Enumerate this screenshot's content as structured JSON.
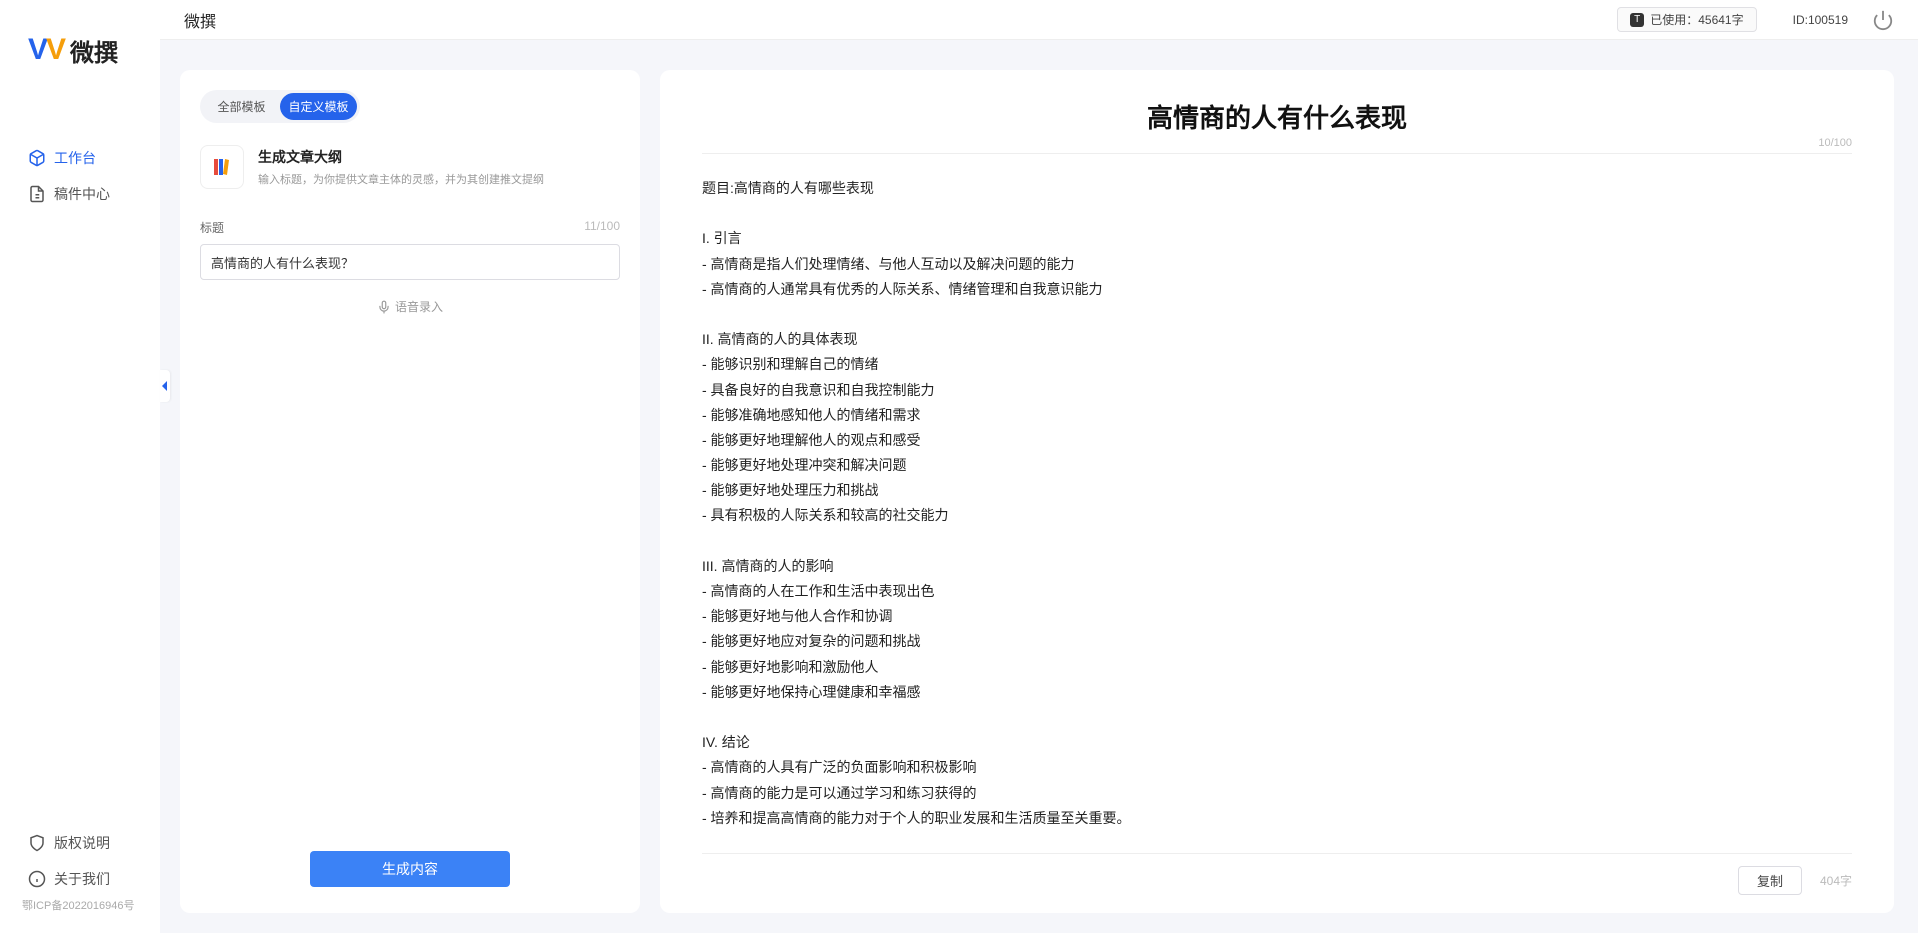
{
  "app": {
    "name": "微撰"
  },
  "logo": {
    "text": "微撰"
  },
  "sidebar": {
    "items": [
      {
        "label": "工作台"
      },
      {
        "label": "稿件中心"
      }
    ],
    "footer": [
      {
        "label": "版权说明"
      },
      {
        "label": "关于我们"
      }
    ],
    "icp": "鄂ICP备2022016946号"
  },
  "topbar": {
    "usage": "已使用：45641字",
    "id": "ID:100519"
  },
  "left": {
    "tabs": {
      "all": "全部模板",
      "custom": "自定义模板"
    },
    "card": {
      "title": "生成文章大纲",
      "subtitle": "输入标题，为你提供文章主体的灵感，并为其创建推文提纲"
    },
    "form": {
      "label": "标题",
      "counter": "11/100",
      "value": "高情商的人有什么表现？",
      "voice": "语音录入"
    },
    "generate": "生成内容"
  },
  "right": {
    "title": "高情商的人有什么表现",
    "title_counter": "10/100",
    "body": "题目:高情商的人有哪些表现\n\nI. 引言\n- 高情商是指人们处理情绪、与他人互动以及解决问题的能力\n- 高情商的人通常具有优秀的人际关系、情绪管理和自我意识能力\n\nII. 高情商的人的具体表现\n- 能够识别和理解自己的情绪\n- 具备良好的自我意识和自我控制能力\n- 能够准确地感知他人的情绪和需求\n- 能够更好地理解他人的观点和感受\n- 能够更好地处理冲突和解决问题\n- 能够更好地处理压力和挑战\n- 具有积极的人际关系和较高的社交能力\n\nIII. 高情商的人的影响\n- 高情商的人在工作和生活中表现出色\n- 能够更好地与他人合作和协调\n- 能够更好地应对复杂的问题和挑战\n- 能够更好地影响和激励他人\n- 能够更好地保持心理健康和幸福感\n\nIV. 结论\n- 高情商的人具有广泛的负面影响和积极影响\n- 高情商的能力是可以通过学习和练习获得的\n- 培养和提高高情商的能力对于个人的职业发展和生活质量至关重要。",
    "copy": "复制",
    "chars": "404字"
  }
}
